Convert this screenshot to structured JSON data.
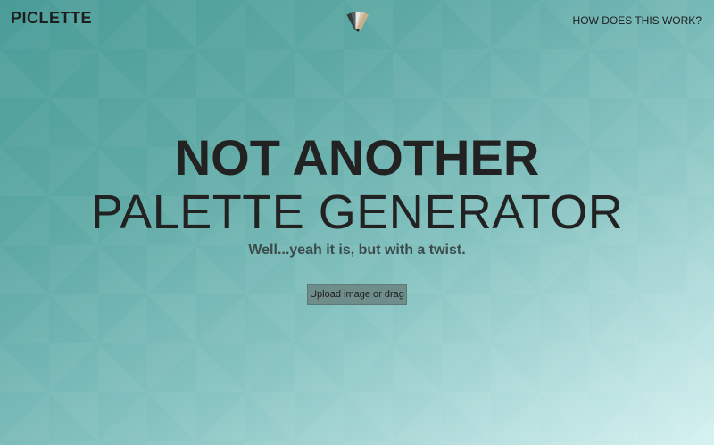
{
  "header": {
    "brand": "PICLETTE",
    "logo_icon": "color-swatch-fan-icon",
    "nav_link": "HOW DOES THIS WORK?"
  },
  "hero": {
    "line1": "NOT ANOTHER",
    "line2": "PALETTE GENERATOR",
    "subtitle": "Well...yeah it is, but with a twist."
  },
  "upload": {
    "label": "Upload image or drag"
  },
  "colors": {
    "background_start": "#4a9c98",
    "background_end": "#d6f1f1",
    "button_bg": "#6f8e8b",
    "text": "#222222"
  }
}
